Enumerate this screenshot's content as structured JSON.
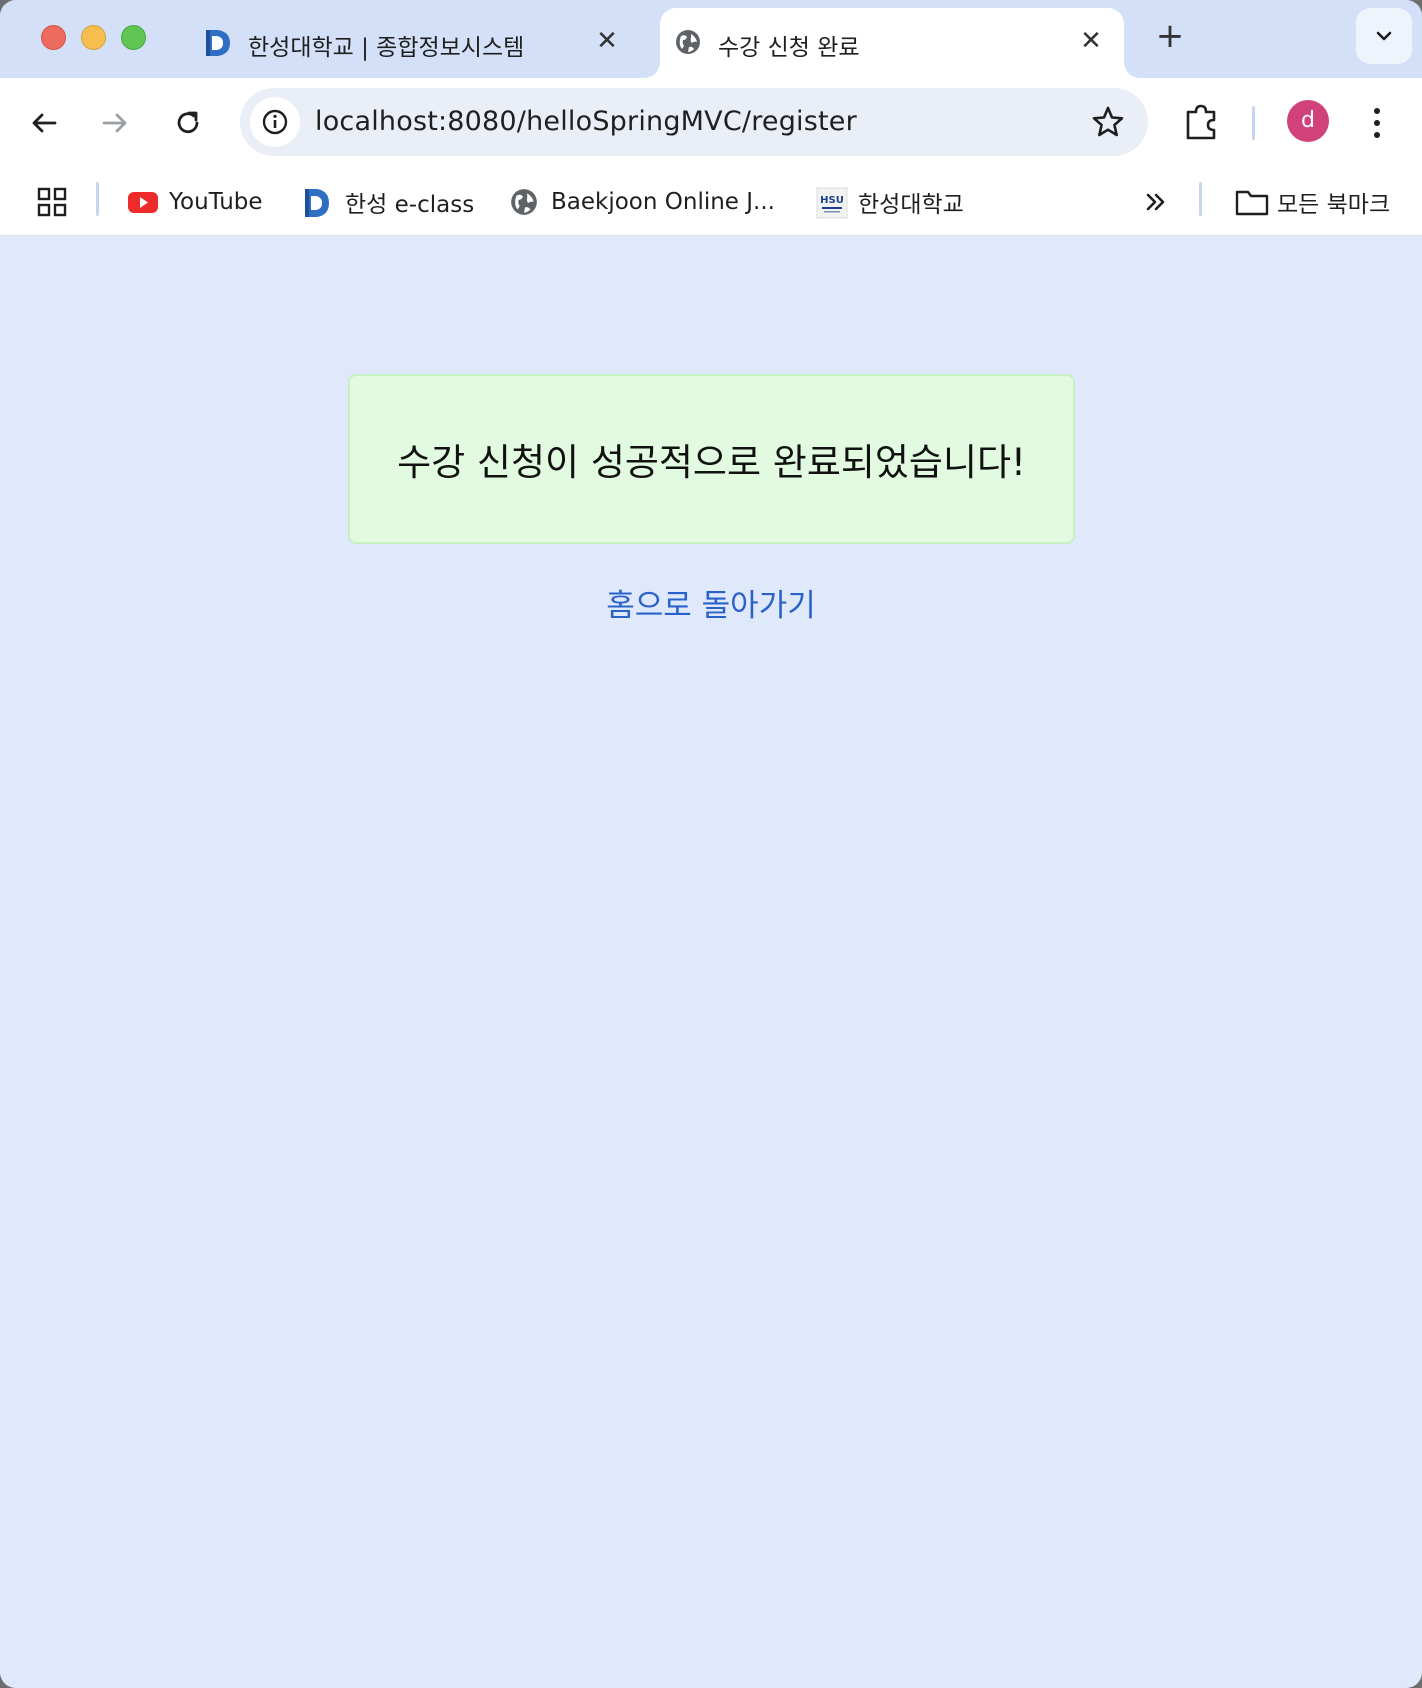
{
  "browser": {
    "tabs": [
      {
        "title": "한성대학교 | 종합정보시스템",
        "favicon": "hansung-d-icon",
        "active": false
      },
      {
        "title": "수강 신청 완료",
        "favicon": "globe-icon",
        "active": true
      }
    ],
    "url": "localhost:8080/helloSpringMVC/register",
    "profile_initial": "d",
    "bookmarks": [
      {
        "label": "YouTube",
        "icon": "youtube-icon"
      },
      {
        "label": "한성 e-class",
        "icon": "hansung-d-icon"
      },
      {
        "label": "Baekjoon Online J...",
        "icon": "globe-icon"
      },
      {
        "label": "한성대학교",
        "icon": "hsu-logo-icon"
      }
    ],
    "all_bookmarks_label": "모든 북마크",
    "colors": {
      "profile": "#d2427a",
      "success_bg": "#e2fbe0",
      "link": "#2a62c9",
      "page_bg": "#dfe9fb"
    }
  },
  "page": {
    "success_message": "수강 신청이 성공적으로 완료되었습니다!",
    "home_link": "홈으로 돌아가기"
  }
}
